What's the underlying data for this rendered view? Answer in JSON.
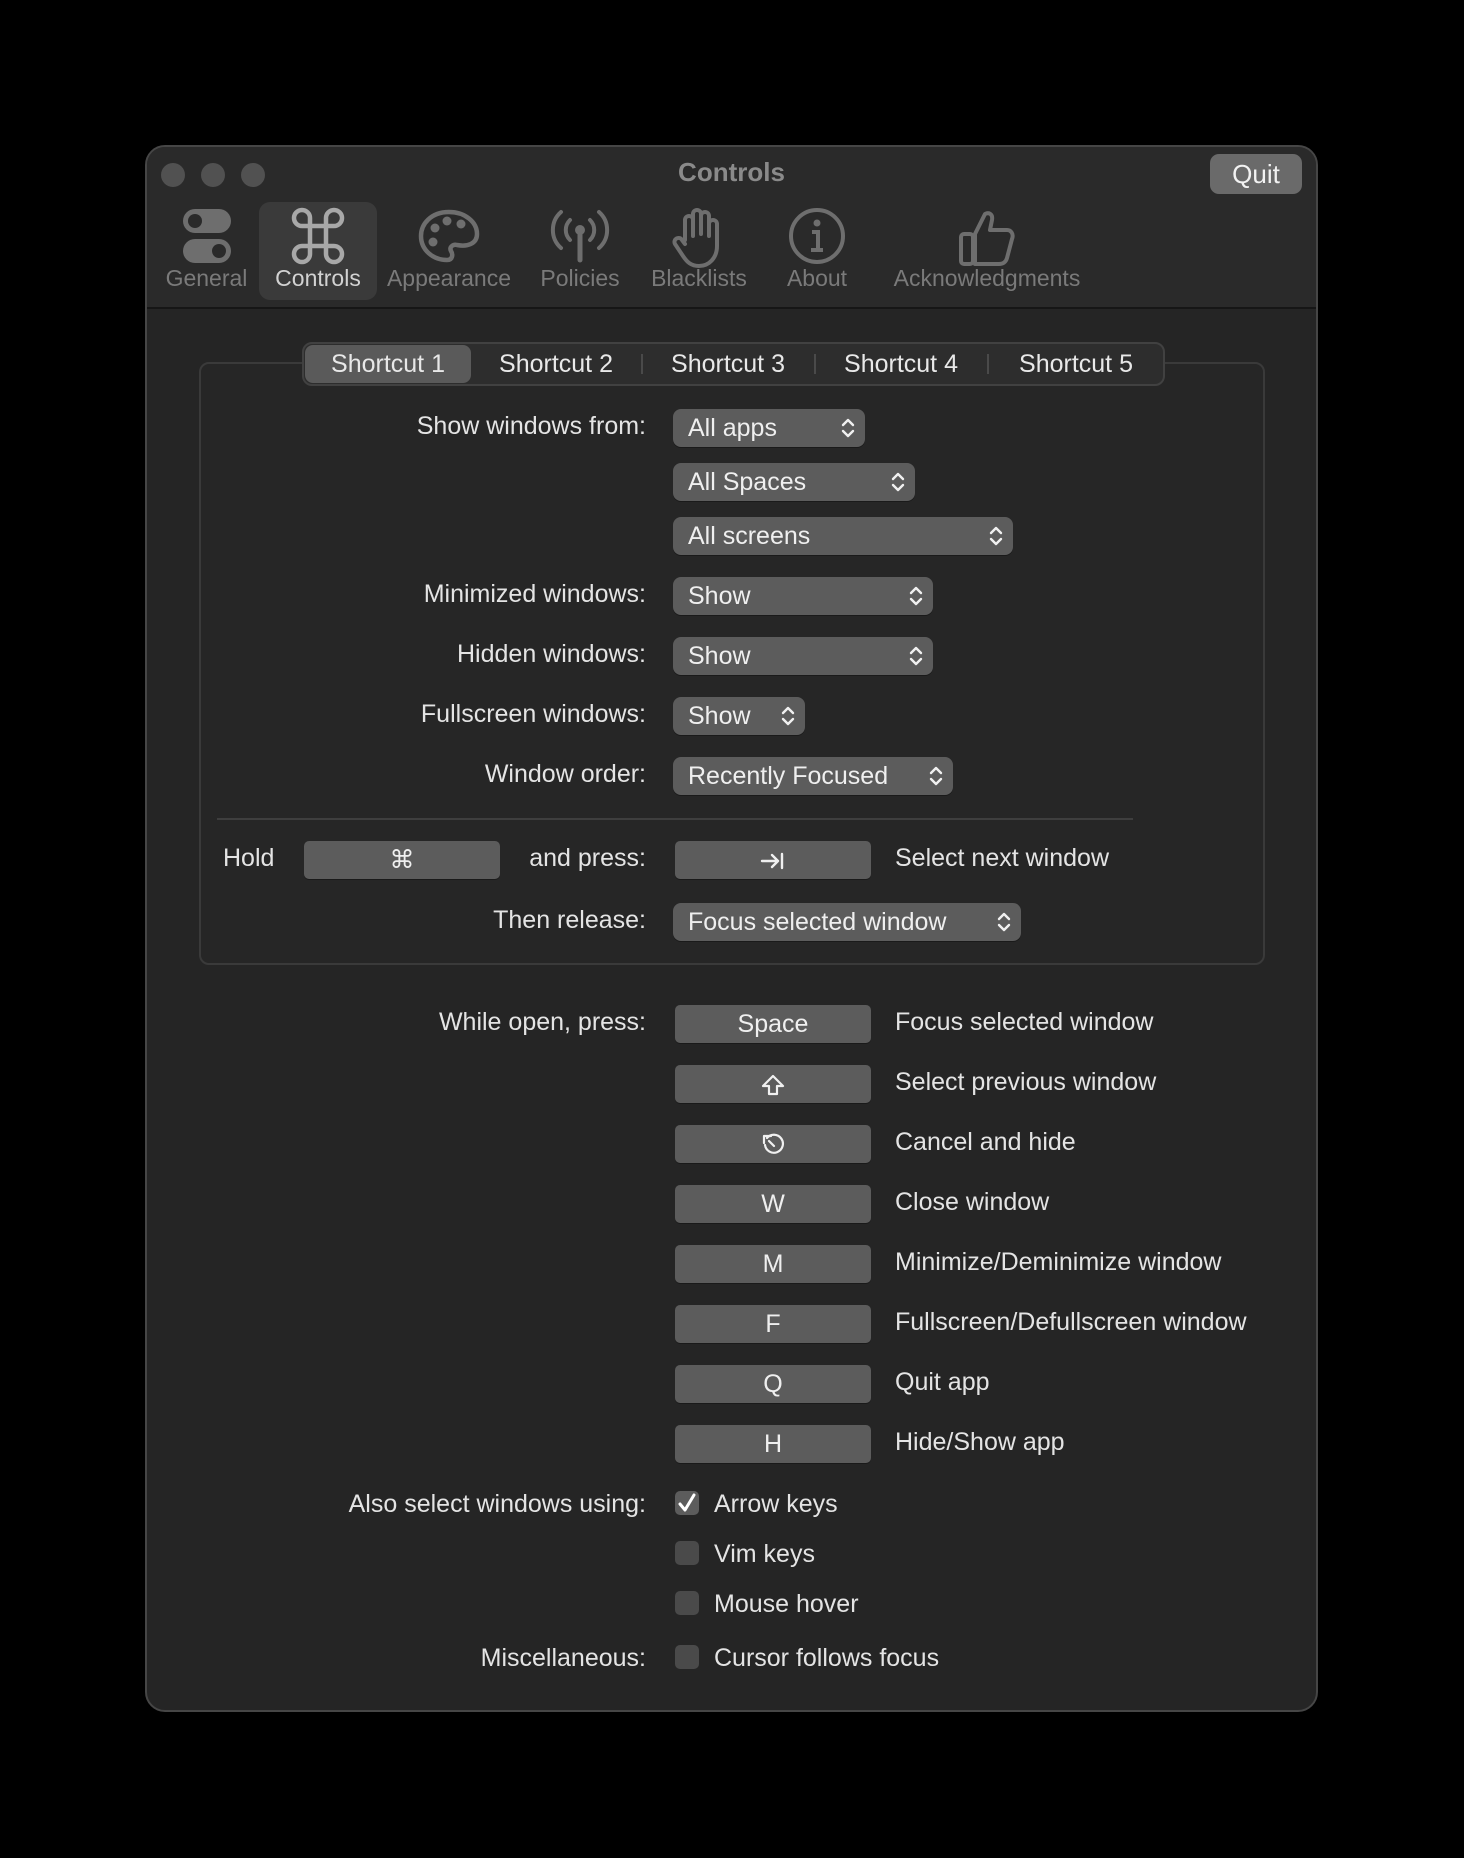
{
  "window": {
    "title": "Controls",
    "quit_label": "Quit"
  },
  "toolbar": {
    "tabs": [
      {
        "label": "General",
        "icon": "toggles-icon"
      },
      {
        "label": "Controls",
        "icon": "command-icon"
      },
      {
        "label": "Appearance",
        "icon": "palette-icon"
      },
      {
        "label": "Policies",
        "icon": "antenna-icon"
      },
      {
        "label": "Blacklists",
        "icon": "hand-icon"
      },
      {
        "label": "About",
        "icon": "info-icon"
      },
      {
        "label": "Acknowledgments",
        "icon": "thumbs-up-icon"
      }
    ],
    "active": "Controls"
  },
  "shortcut_tabs": [
    "Shortcut 1",
    "Shortcut 2",
    "Shortcut 3",
    "Shortcut 4",
    "Shortcut 5"
  ],
  "shortcut_tab_active": "Shortcut 1",
  "shortcut": {
    "show_windows_from_label": "Show windows from:",
    "apps_value": "All apps",
    "spaces_value": "All Spaces",
    "screens_value": "All screens",
    "minimized_label": "Minimized windows:",
    "minimized_value": "Show",
    "hidden_label": "Hidden windows:",
    "hidden_value": "Show",
    "fullscreen_label": "Fullscreen windows:",
    "fullscreen_value": "Show",
    "order_label": "Window order:",
    "order_value": "Recently Focused",
    "hold_label": "Hold",
    "hold_key": "⌘",
    "and_press_label": "and press:",
    "press_key_icon": "tab-icon",
    "select_next_label": "Select next window",
    "then_release_label": "Then release:",
    "then_release_value": "Focus selected window"
  },
  "while_open": {
    "label": "While open, press:",
    "rows": [
      {
        "key": "Space",
        "action": "Focus selected window"
      },
      {
        "key": "",
        "key_icon": "shift-icon",
        "action": "Select previous window"
      },
      {
        "key": "",
        "key_icon": "escape-icon",
        "action": "Cancel and hide"
      },
      {
        "key": "W",
        "action": "Close window"
      },
      {
        "key": "M",
        "action": "Minimize/Deminimize window"
      },
      {
        "key": "F",
        "action": "Fullscreen/Defullscreen window"
      },
      {
        "key": "Q",
        "action": "Quit app"
      },
      {
        "key": "H",
        "action": "Hide/Show app"
      }
    ]
  },
  "also_select": {
    "label": "Also select windows using:",
    "options": [
      {
        "label": "Arrow keys",
        "checked": true
      },
      {
        "label": "Vim keys",
        "checked": false
      },
      {
        "label": "Mouse hover",
        "checked": false
      }
    ]
  },
  "misc": {
    "label": "Miscellaneous:",
    "option": {
      "label": "Cursor follows focus",
      "checked": false
    }
  }
}
